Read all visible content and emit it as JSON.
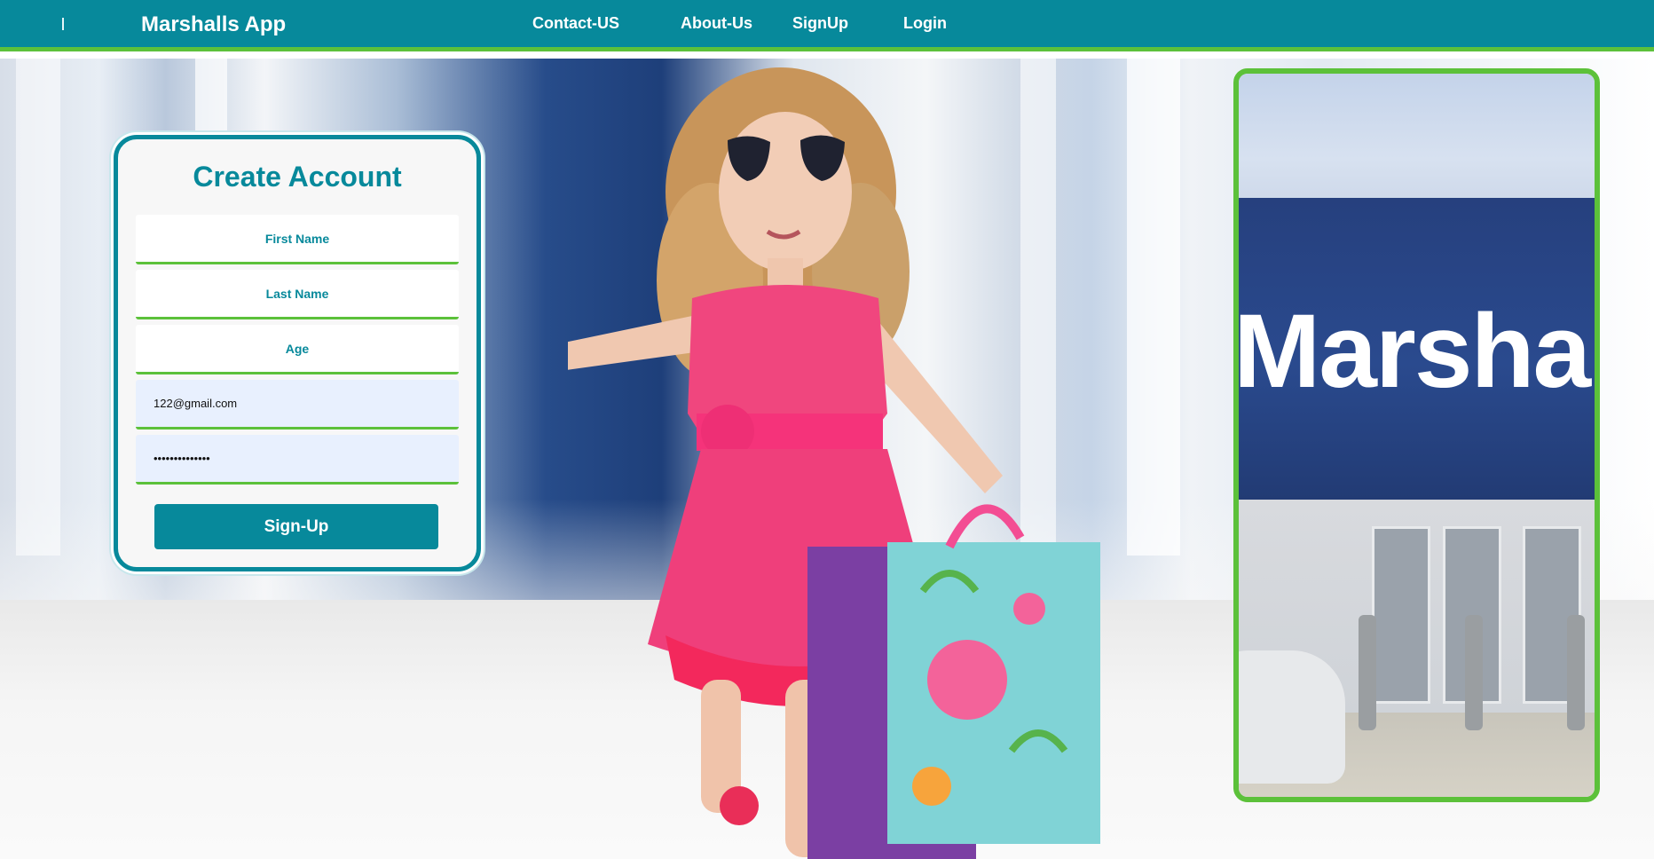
{
  "nav": {
    "brand": "Marshalls App",
    "links": [
      "Contact-US",
      "About-Us",
      "SignUp",
      "Login"
    ]
  },
  "signup_form": {
    "title": "Create Account",
    "first_name_placeholder": "First Name",
    "last_name_placeholder": "Last Name",
    "age_placeholder": "Age",
    "email_value": "122@gmail.com",
    "password_value": "••••••••••••••",
    "submit_label": "Sign-Up"
  },
  "store_image": {
    "sign_text": "Marsha"
  },
  "colors": {
    "primary": "#07899b",
    "accent": "#5cc13a",
    "form_bg": "#f7f7f7",
    "autofill_bg": "#e8f0fe"
  }
}
